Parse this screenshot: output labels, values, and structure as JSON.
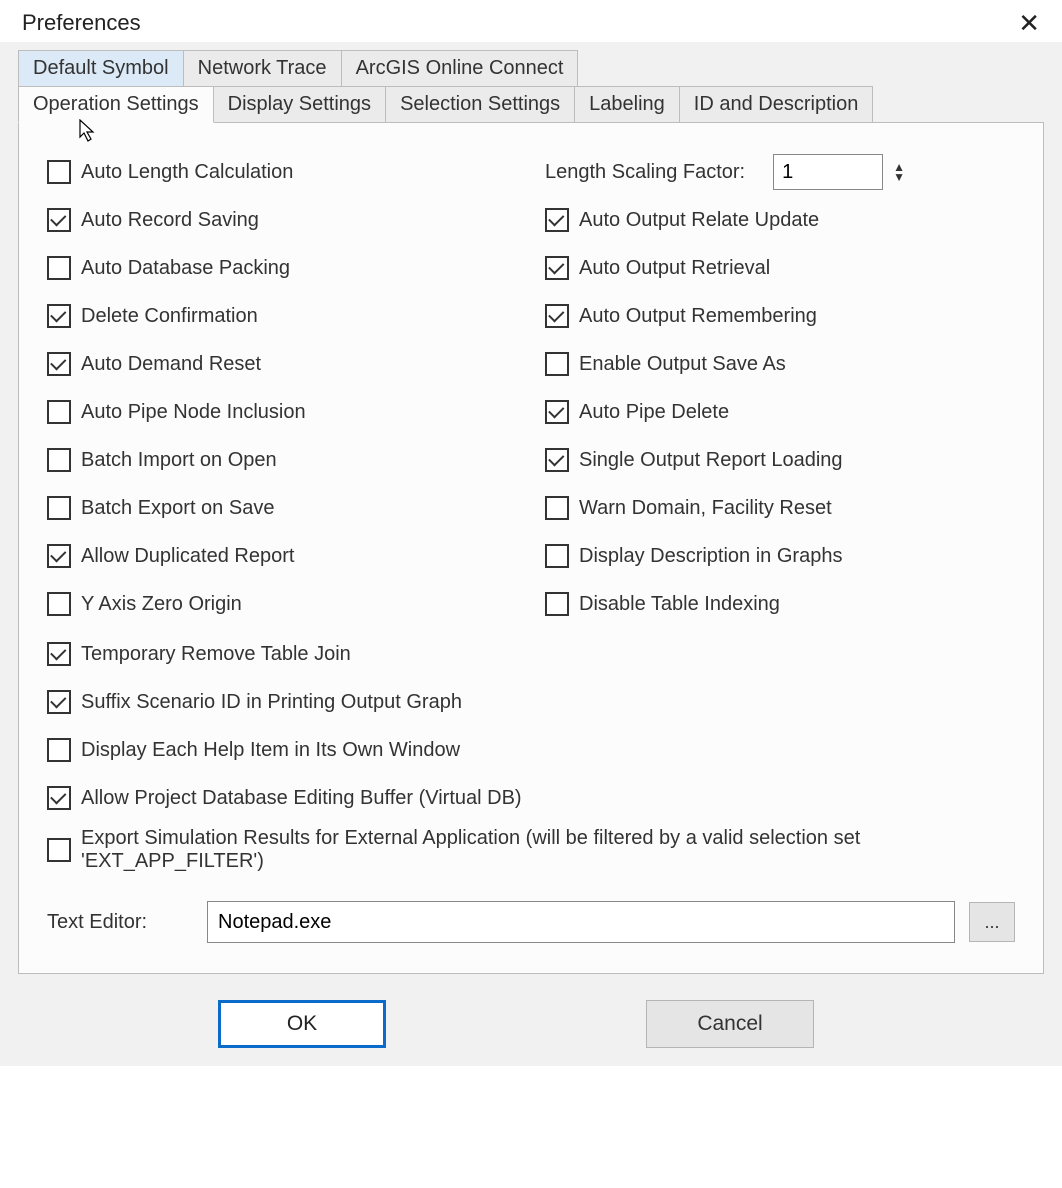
{
  "window": {
    "title": "Preferences"
  },
  "tabs_row1": [
    {
      "label": "Default Symbol"
    },
    {
      "label": "Network Trace"
    },
    {
      "label": "ArcGIS Online Connect"
    }
  ],
  "tabs_row2": [
    {
      "label": "Operation Settings"
    },
    {
      "label": "Display Settings"
    },
    {
      "label": "Selection Settings"
    },
    {
      "label": "Labeling"
    },
    {
      "label": "ID and Description"
    }
  ],
  "scaling": {
    "label": "Length Scaling Factor:",
    "value": "1"
  },
  "left": [
    {
      "label": "Auto Length Calculation",
      "checked": false
    },
    {
      "label": "Auto Record Saving",
      "checked": true
    },
    {
      "label": "Auto Database Packing",
      "checked": false
    },
    {
      "label": "Delete Confirmation",
      "checked": true
    },
    {
      "label": "Auto Demand Reset",
      "checked": true
    },
    {
      "label": "Auto Pipe Node Inclusion",
      "checked": false
    },
    {
      "label": "Batch Import on Open",
      "checked": false
    },
    {
      "label": "Batch Export on Save",
      "checked": false
    },
    {
      "label": "Allow Duplicated Report",
      "checked": true
    },
    {
      "label": "Y Axis Zero Origin",
      "checked": false
    }
  ],
  "right": [
    {
      "label": "Auto Output Relate Update",
      "checked": true
    },
    {
      "label": "Auto Output Retrieval",
      "checked": true
    },
    {
      "label": "Auto Output Remembering",
      "checked": true
    },
    {
      "label": "Enable Output Save As",
      "checked": false
    },
    {
      "label": "Auto Pipe Delete",
      "checked": true
    },
    {
      "label": "Single Output Report Loading",
      "checked": true
    },
    {
      "label": "Warn Domain, Facility Reset",
      "checked": false
    },
    {
      "label": "Display Description in Graphs",
      "checked": false
    },
    {
      "label": "Disable Table Indexing",
      "checked": false
    }
  ],
  "full": [
    {
      "label": "Temporary Remove Table Join",
      "checked": true
    },
    {
      "label": "Suffix Scenario ID in Printing Output Graph",
      "checked": true
    },
    {
      "label": "Display Each Help Item in Its Own Window",
      "checked": false
    },
    {
      "label": "Allow Project Database Editing Buffer (Virtual DB)",
      "checked": true
    },
    {
      "label": "Export Simulation Results for External Application (will be filtered by a valid selection set 'EXT_APP_FILTER')",
      "checked": false
    }
  ],
  "texteditor": {
    "label": "Text Editor:",
    "value": "Notepad.exe",
    "browse": "..."
  },
  "buttons": {
    "ok": "OK",
    "cancel": "Cancel"
  }
}
